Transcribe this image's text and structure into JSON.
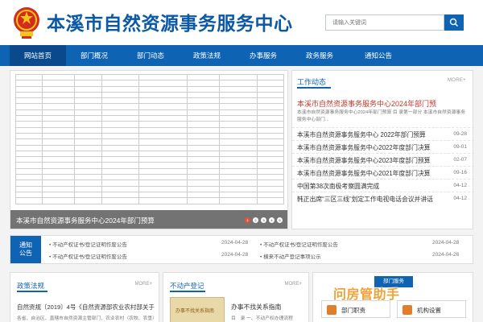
{
  "header": {
    "site_title": "本溪市自然资源事务服务中心",
    "search_placeholder": "请输入关键词"
  },
  "nav": {
    "items": [
      {
        "label": "网站首页",
        "active": true
      },
      {
        "label": "部门概况",
        "active": false
      },
      {
        "label": "部门动态",
        "active": false
      },
      {
        "label": "政策法规",
        "active": false
      },
      {
        "label": "办事服务",
        "active": false
      },
      {
        "label": "政务服务",
        "active": false
      },
      {
        "label": "通知公告",
        "active": false
      }
    ]
  },
  "banner": {
    "caption": "本溪市自然资源事务服务中心2024年部门预算",
    "dots": [
      "1",
      "2",
      "3",
      "4",
      "5"
    ],
    "active_dot": 1
  },
  "work_news": {
    "title": "工作动态",
    "more": "MORE+",
    "headline": "本溪市自然资源事务服务中心2024年部门预",
    "summary": "本溪市自然资源事务服务中心2024年部门预算 目 录第一部分 本溪市自然资源事务服务中心部门...",
    "items": [
      {
        "title": "本溪市自然资源事务服务中心 2022年部门预算",
        "date": "09-28"
      },
      {
        "title": "本溪市自然资源事务服务中心2022年度部门决算",
        "date": "09-01"
      },
      {
        "title": "本溪市自然资源事务服务中心2023年度部门预算",
        "date": "02-07"
      },
      {
        "title": "本溪市自然资源事务服务中心2021年度部门决算",
        "date": "09-16"
      },
      {
        "title": "中国第38次南极考察圆满完成",
        "date": "04-12"
      },
      {
        "title": "韩正出席“三区三线”划定工作电视电话会议并讲话",
        "date": "04-12"
      }
    ]
  },
  "notice": {
    "badge_line1": "通知",
    "badge_line2": "公告",
    "items": [
      {
        "title": "• 不动产权证书/登记证明作废公告",
        "date": "2024-04-28"
      },
      {
        "title": "• 不动产权证书/登记证明作废公告",
        "date": "2024-04-28"
      },
      {
        "title": "• 不动产权证书/登记证明作废公告",
        "date": "2024-04-28"
      },
      {
        "title": "• 横来不动产登记事项公示",
        "date": "2024-04-26"
      }
    ]
  },
  "policy": {
    "title": "政策法规",
    "more": "MORE+",
    "headline": "自然资规〔2019〕4号《自然资源部农业农村部关于",
    "summary": "各省、自治区、直辖市自然资源主管部门、农业农村（农牧、农垦）"
  },
  "estate": {
    "title": "不动产登记",
    "more": "MORE+",
    "book_text": "办事不找关系指南",
    "guide_title": "办事不找关系指南",
    "guide_sub": "目　录 一、不动产权办理流程"
  },
  "service": {
    "header": "部门服务",
    "buttons": [
      "部门职责",
      "机构设置"
    ]
  },
  "watermark": "问房管助手",
  "colors": {
    "primary": "#0e63b3",
    "nav_active": "#0a4a8c",
    "headline_red": "#c0392b",
    "accent_orange": "#e07e2c"
  }
}
